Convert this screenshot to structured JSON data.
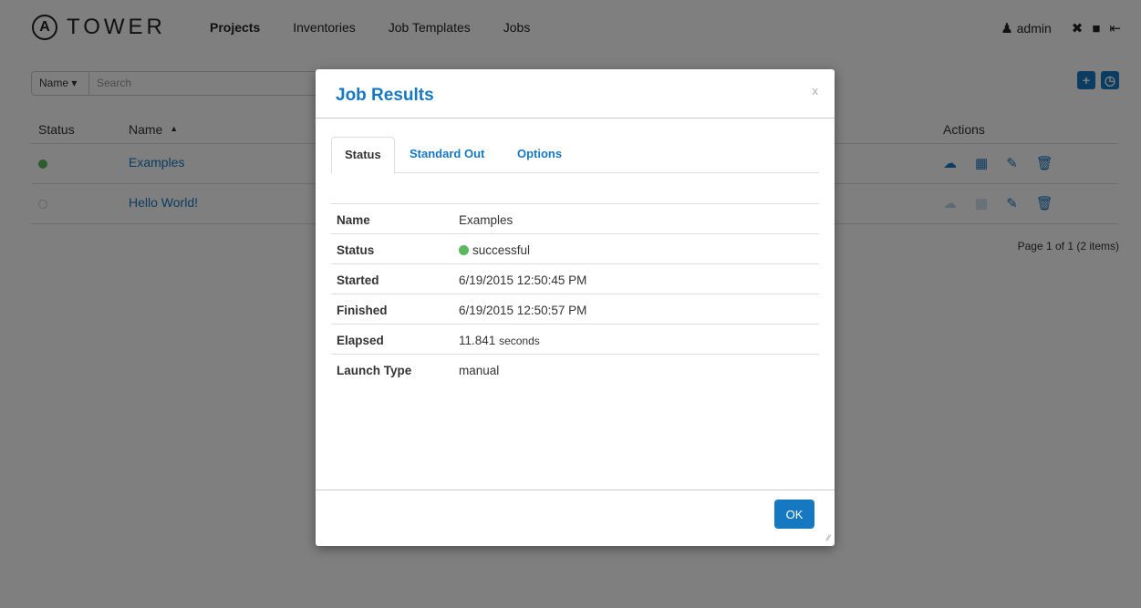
{
  "app": {
    "logo_letter": "A",
    "logo_name": "TOWER"
  },
  "nav": {
    "links": [
      "Projects",
      "Inventories",
      "Job Templates",
      "Jobs"
    ],
    "user": "admin"
  },
  "search": {
    "field": "Name ▾",
    "placeholder": "Search"
  },
  "table": {
    "headers": {
      "status": "Status",
      "name": "Name",
      "sort_indicator": "▲",
      "actions": "Actions"
    },
    "rows": [
      {
        "status_color": "#5cb85c",
        "name": "Examples"
      },
      {
        "status_color": "#e0e0e0",
        "name": "Hello World!"
      }
    ],
    "pager": "Page 1 of 1 (2 items)"
  },
  "modal": {
    "title": "Job Results",
    "close": "x",
    "tabs": [
      "Status",
      "Standard Out",
      "Options"
    ],
    "details": [
      {
        "label": "Name",
        "value": "Examples"
      },
      {
        "label": "Status",
        "value": "successful"
      },
      {
        "label": "Started",
        "value": "6/19/2015 12:50:45 PM"
      },
      {
        "label": "Finished",
        "value": "6/19/2015 12:50:57 PM"
      },
      {
        "label": "Elapsed",
        "value": "11.841",
        "unit": "seconds"
      },
      {
        "label": "Launch Type",
        "value": "manual"
      }
    ],
    "ok_label": "OK"
  },
  "colors": {
    "accent": "#1778c2",
    "success": "#5cb85c"
  }
}
